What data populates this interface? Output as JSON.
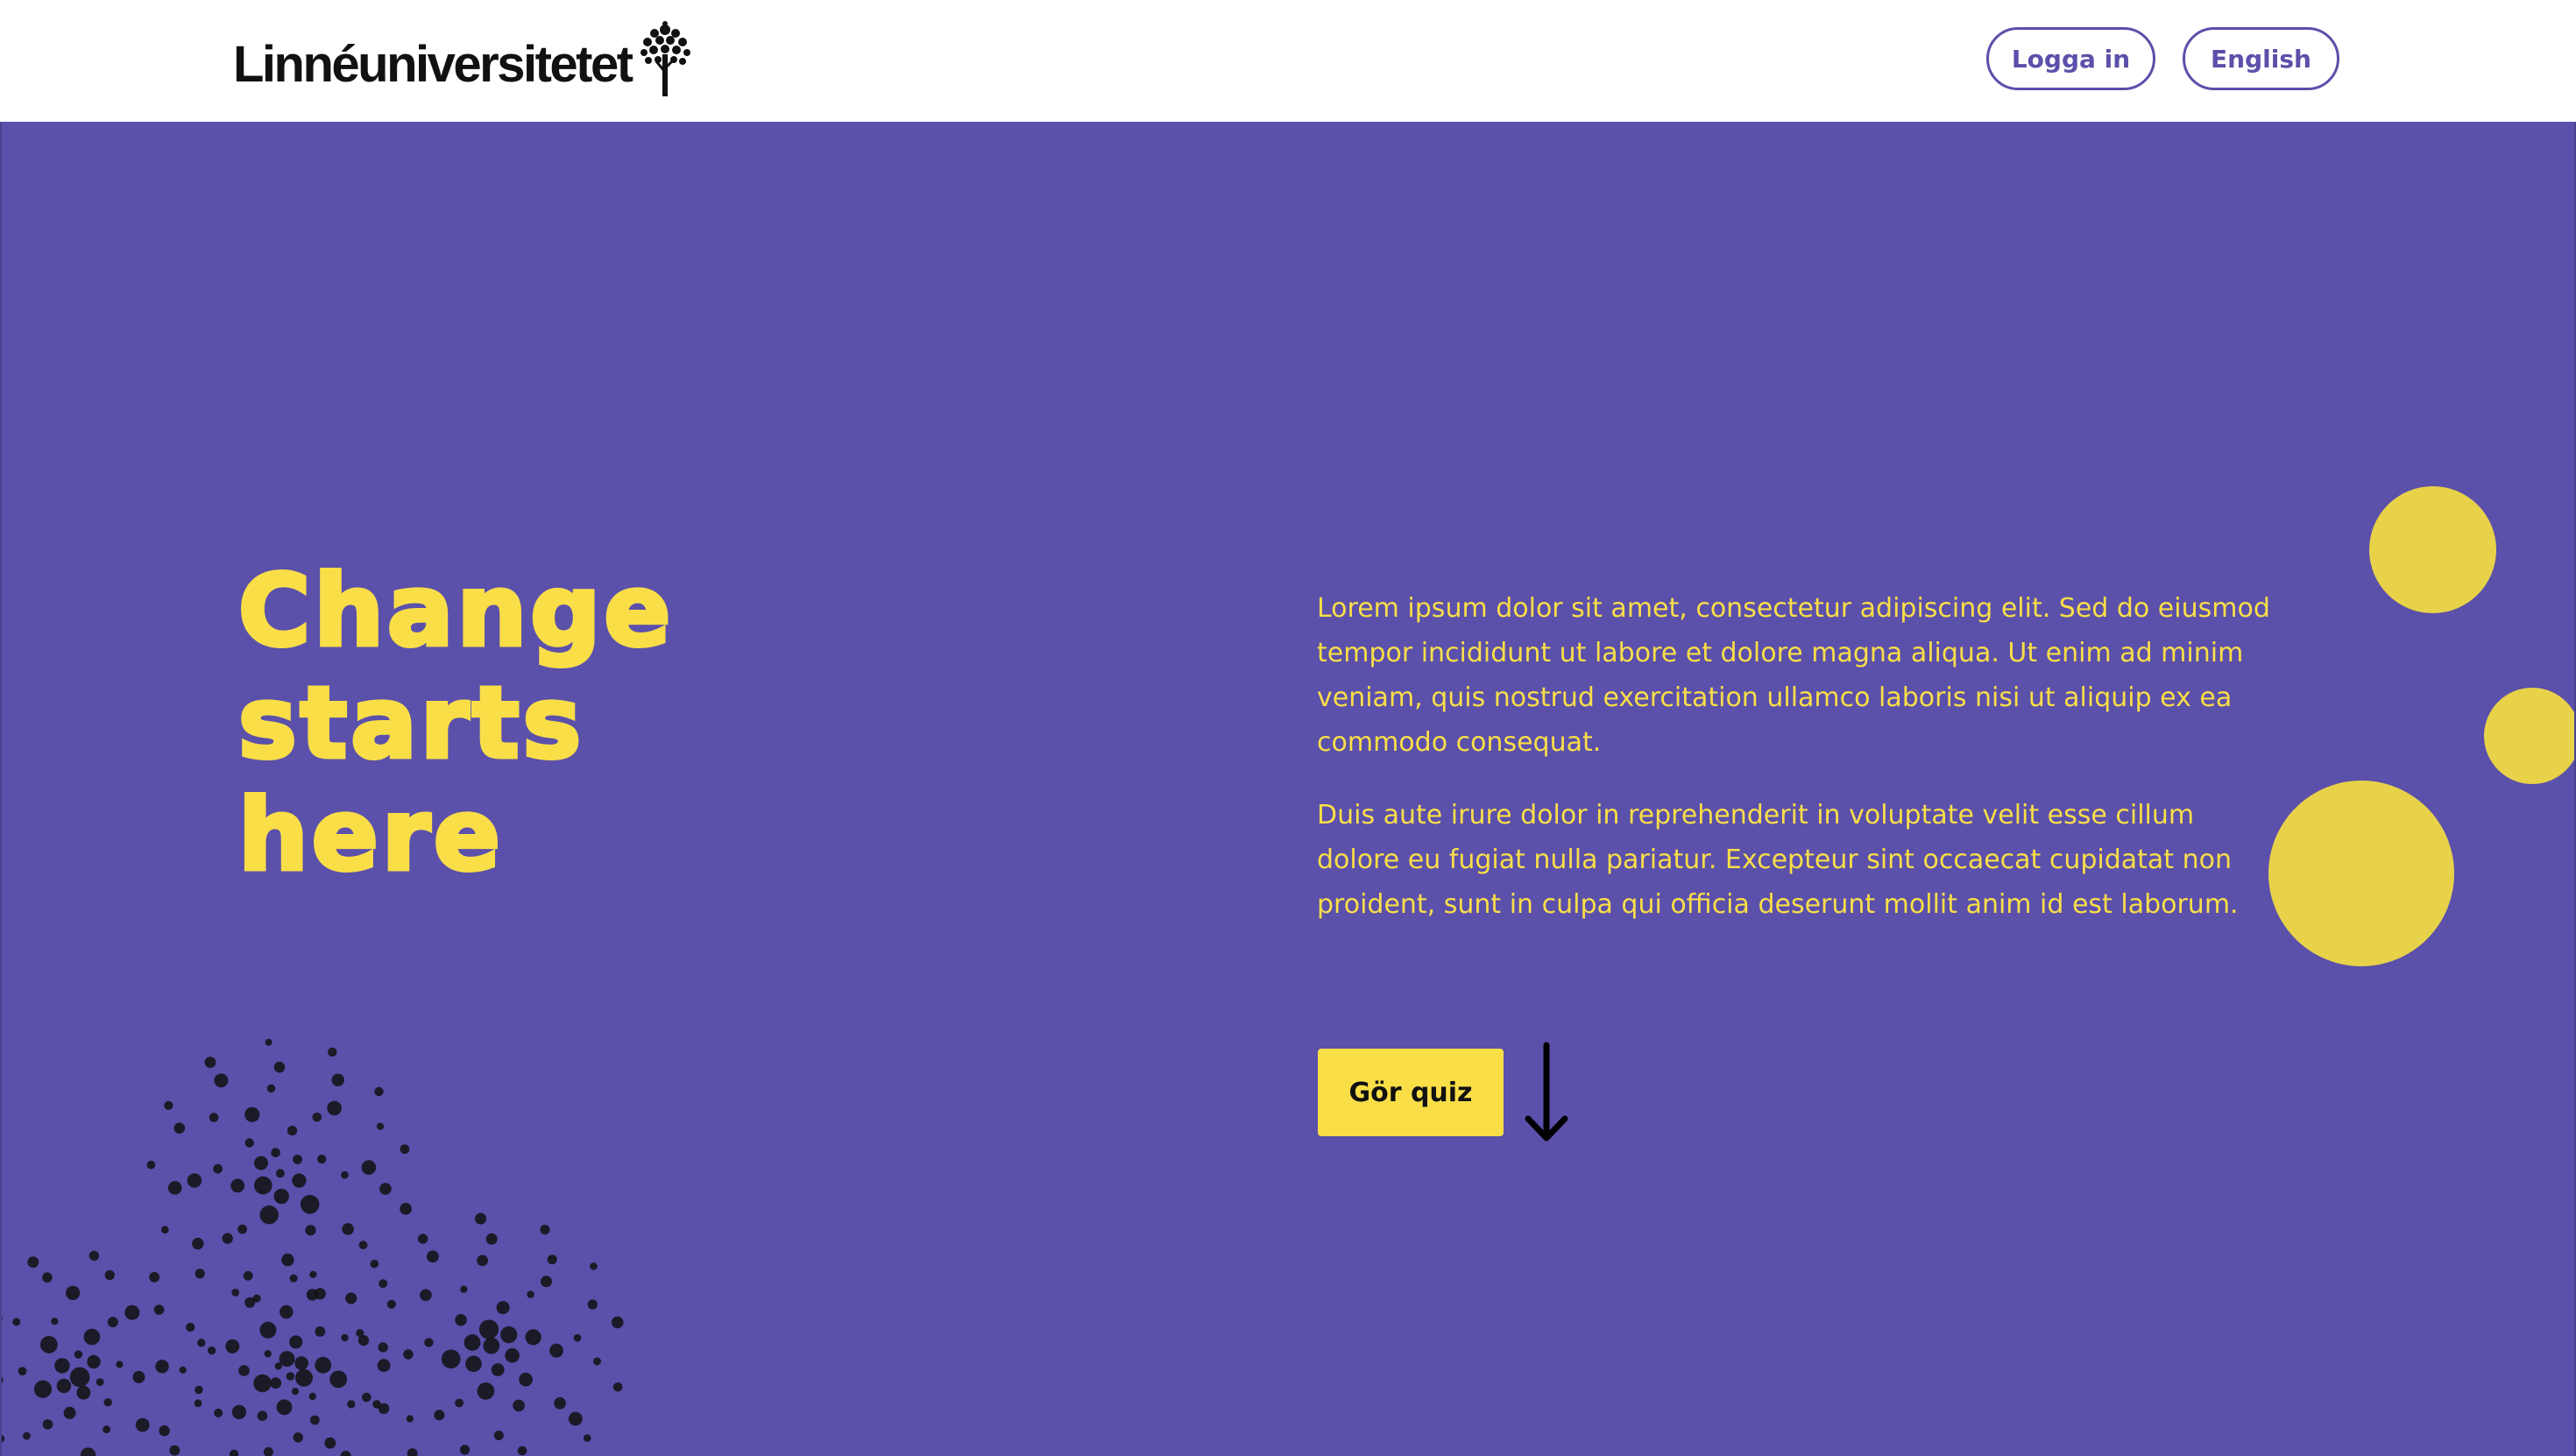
{
  "header": {
    "logo_text": "Linnéuniversitetet",
    "login_label": "Logga in",
    "language_label": "English"
  },
  "hero": {
    "title_lines": [
      "Change",
      "starts",
      "here"
    ],
    "paragraphs": [
      "Lorem ipsum dolor sit amet, consectetur adipiscing elit. Sed do eiusmod tempor incididunt ut labore et dolore magna aliqua. Ut enim ad minim veniam, quis nostrud exercitation ullamco laboris nisi ut aliquip ex ea commodo consequat.",
      "Duis aute irure dolor in reprehenderit in voluptate velit esse cillum dolore eu fugiat nulla pariatur. Excepteur sint occaecat cupidatat non proident, sunt in culpa qui officia deserunt mollit anim id est laborum."
    ],
    "quiz_label": "Gör quiz"
  },
  "icons": {
    "logo": "tree-icon",
    "scroll": "arrow-down-icon",
    "decoration": "dots-pattern"
  },
  "colors": {
    "primary_purple": "#5b50aa",
    "accent_yellow": "#f9de48",
    "circle_yellow": "#e8d24a",
    "dark": "#111111"
  }
}
